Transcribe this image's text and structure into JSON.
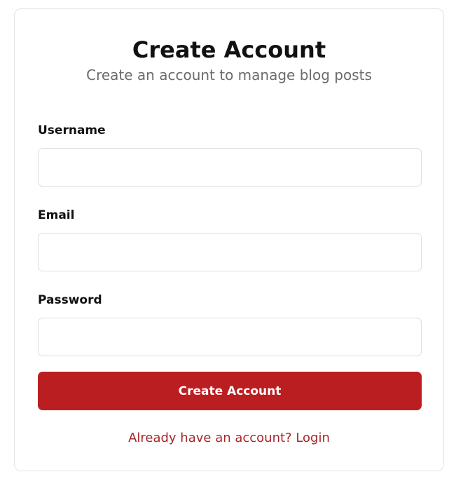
{
  "card": {
    "title": "Create Account",
    "subtitle": "Create an account to manage blog posts"
  },
  "form": {
    "username": {
      "label": "Username",
      "value": "",
      "placeholder": ""
    },
    "email": {
      "label": "Email",
      "value": "",
      "placeholder": ""
    },
    "password": {
      "label": "Password",
      "value": "",
      "placeholder": ""
    },
    "submit_label": "Create Account"
  },
  "footer": {
    "login_link": "Already have an account? Login"
  },
  "colors": {
    "accent": "#bb1e21",
    "link": "#a8262a",
    "subtitle": "#6b6b6b",
    "border": "#dedede"
  }
}
